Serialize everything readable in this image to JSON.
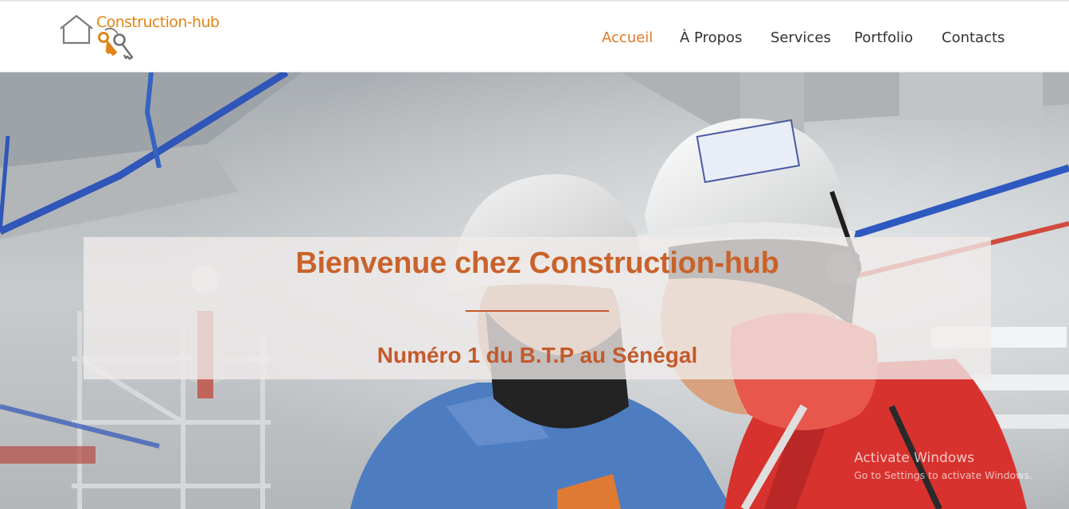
{
  "logo": {
    "text": "Construction-hub",
    "icon": "house-with-keys-icon",
    "brand_color": "#e08416"
  },
  "nav": {
    "items": [
      {
        "label": "Accueil",
        "active": true
      },
      {
        "label": "À Propos",
        "active": false
      },
      {
        "label": "Services",
        "active": false
      },
      {
        "label": "Portfolio",
        "active": false
      },
      {
        "label": "Contacts",
        "active": false
      }
    ],
    "active_color": "#e07a2c",
    "text_color": "#333333"
  },
  "hero": {
    "image": "construction-workers-hard-hats-photo",
    "title": "Bienvenue chez Construction-hub",
    "subtitle": "Numéro 1 du B.T.P au Sénégal",
    "accent_color": "#c45a2c"
  },
  "watermark": {
    "title": "Activate Windows",
    "subtitle": "Go to Settings to activate Windows."
  }
}
